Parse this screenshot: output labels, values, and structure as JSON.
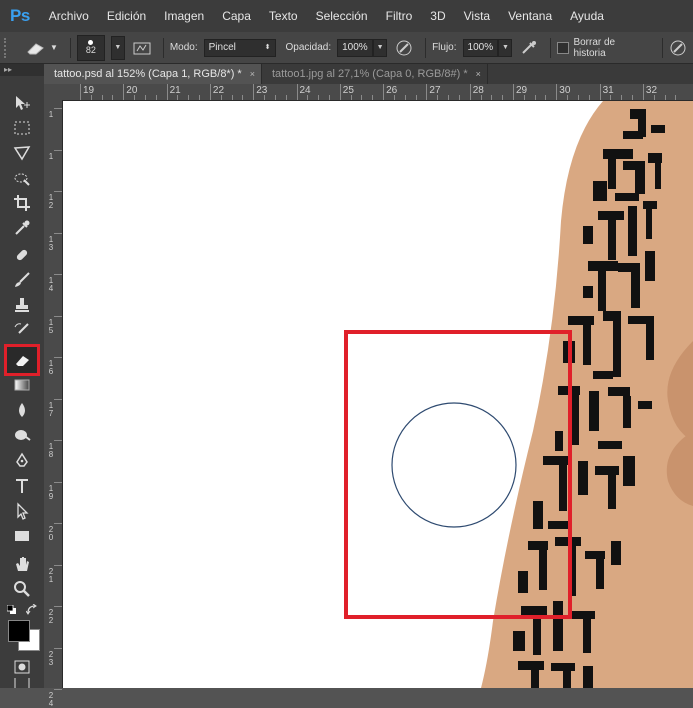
{
  "app": {
    "logo": "Ps"
  },
  "menu": [
    "Archivo",
    "Edición",
    "Imagen",
    "Capa",
    "Texto",
    "Selección",
    "Filtro",
    "3D",
    "Vista",
    "Ventana",
    "Ayuda"
  ],
  "options": {
    "brush_size": "82",
    "mode_label": "Modo:",
    "mode_value": "Pincel",
    "opacity_label": "Opacidad:",
    "opacity_value": "100%",
    "flow_label": "Flujo:",
    "flow_value": "100%",
    "erase_history_label": "Borrar de historia",
    "erase_history_checked": false
  },
  "tabs": [
    {
      "label": "tattoo.psd al 152% (Capa 1, RGB/8*) *",
      "active": true,
      "close": "×"
    },
    {
      "label": "tattoo1.jpg al 27,1% (Capa 0, RGB/8#) *",
      "active": false,
      "close": "×"
    }
  ],
  "toolbox": {
    "header": "▸▸",
    "tools": [
      "move-icon",
      "marquee-icon",
      "lasso-icon",
      "quick-select-icon",
      "crop-icon",
      "eyedropper-icon",
      "healing-icon",
      "brush-icon",
      "stamp-icon",
      "history-brush-icon",
      "eraser-icon",
      "gradient-icon",
      "blur-icon",
      "dodge-icon",
      "pen-icon",
      "type-icon",
      "path-select-icon",
      "rectangle-icon",
      "hand-icon",
      "zoom-icon"
    ],
    "active_tool": "eraser-icon",
    "foreground_color": "#000000",
    "background_color": "#ffffff"
  },
  "ruler_top": [
    "19",
    "20",
    "21",
    "22",
    "23",
    "24",
    "25",
    "26",
    "27",
    "28",
    "29",
    "30",
    "31",
    "32"
  ],
  "ruler_left": [
    "1",
    "1",
    "1 2",
    "1 3",
    "1 4",
    "1 5",
    "1 6",
    "1 7",
    "1 8",
    "1 9",
    "2 0",
    "2 1",
    "2 2",
    "2 3",
    "2 4"
  ],
  "colors": {
    "highlight": "#e0202a",
    "brush_cursor": "#2e4a70",
    "skin": "#d9a882",
    "tattoo_ink": "#111111"
  }
}
